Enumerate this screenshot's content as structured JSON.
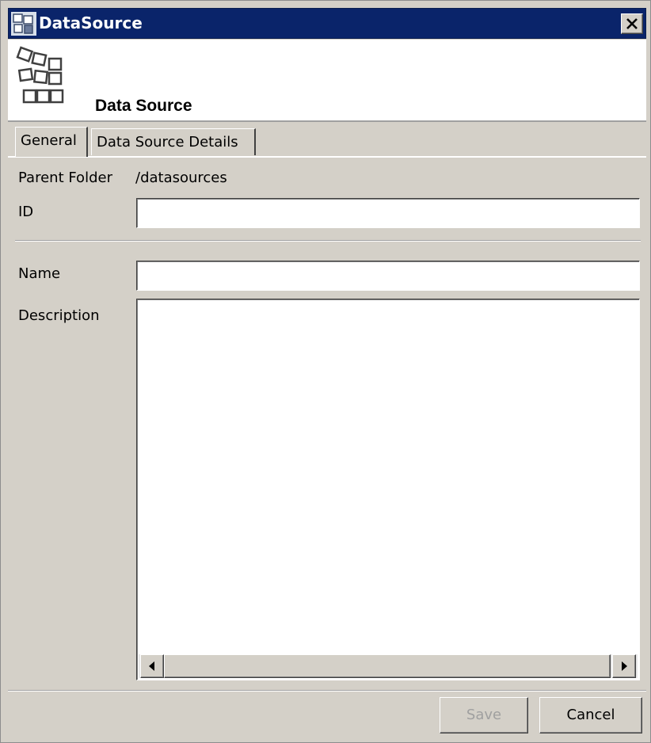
{
  "window": {
    "title": "DataSource",
    "app_icon": "datasource-app-icon",
    "close_icon": "close-icon"
  },
  "header": {
    "title": "Data Source",
    "icon": "datasource-grid-icon"
  },
  "tabs": [
    {
      "label": "General",
      "selected": true
    },
    {
      "label": "Data Source Details",
      "selected": false
    }
  ],
  "form": {
    "parent_folder_label": "Parent Folder",
    "parent_folder_value": "/datasources",
    "id_label": "ID",
    "id_value": "",
    "name_label": "Name",
    "name_value": "",
    "description_label": "Description",
    "description_value": ""
  },
  "scrollbar": {
    "left_icon": "scroll-left-arrow-icon",
    "right_icon": "scroll-right-arrow-icon"
  },
  "buttons": {
    "save": {
      "label": "Save",
      "enabled": false
    },
    "cancel": {
      "label": "Cancel",
      "enabled": true
    }
  },
  "colors": {
    "titlebar": "#0a246a",
    "window_bg": "#d4d0c8",
    "disabled_text": "#a0a0a0"
  }
}
